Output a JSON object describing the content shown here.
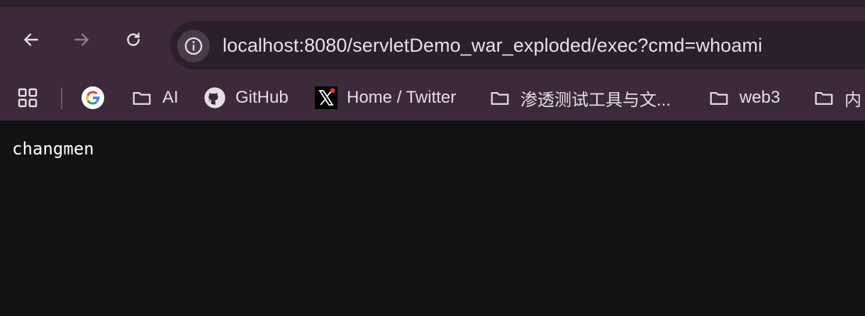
{
  "address_bar": {
    "url": "localhost:8080/servletDemo_war_exploded/exec?cmd=whoami"
  },
  "bookmarks": [
    {
      "label": "",
      "icon": "google-icon"
    },
    {
      "label": "AI",
      "icon": "folder-icon"
    },
    {
      "label": "GitHub",
      "icon": "github-icon"
    },
    {
      "label": "Home / Twitter",
      "icon": "x-icon"
    },
    {
      "label": "渗透测试工具与文...",
      "icon": "folder-icon"
    },
    {
      "label": "web3",
      "icon": "folder-icon"
    },
    {
      "label": "内",
      "icon": "folder-icon"
    }
  ],
  "page": {
    "output": "changmen"
  },
  "colors": {
    "chrome_bg": "#3c2a3c",
    "omnibox_bg": "#2a1f2b",
    "content_bg": "#121212"
  }
}
